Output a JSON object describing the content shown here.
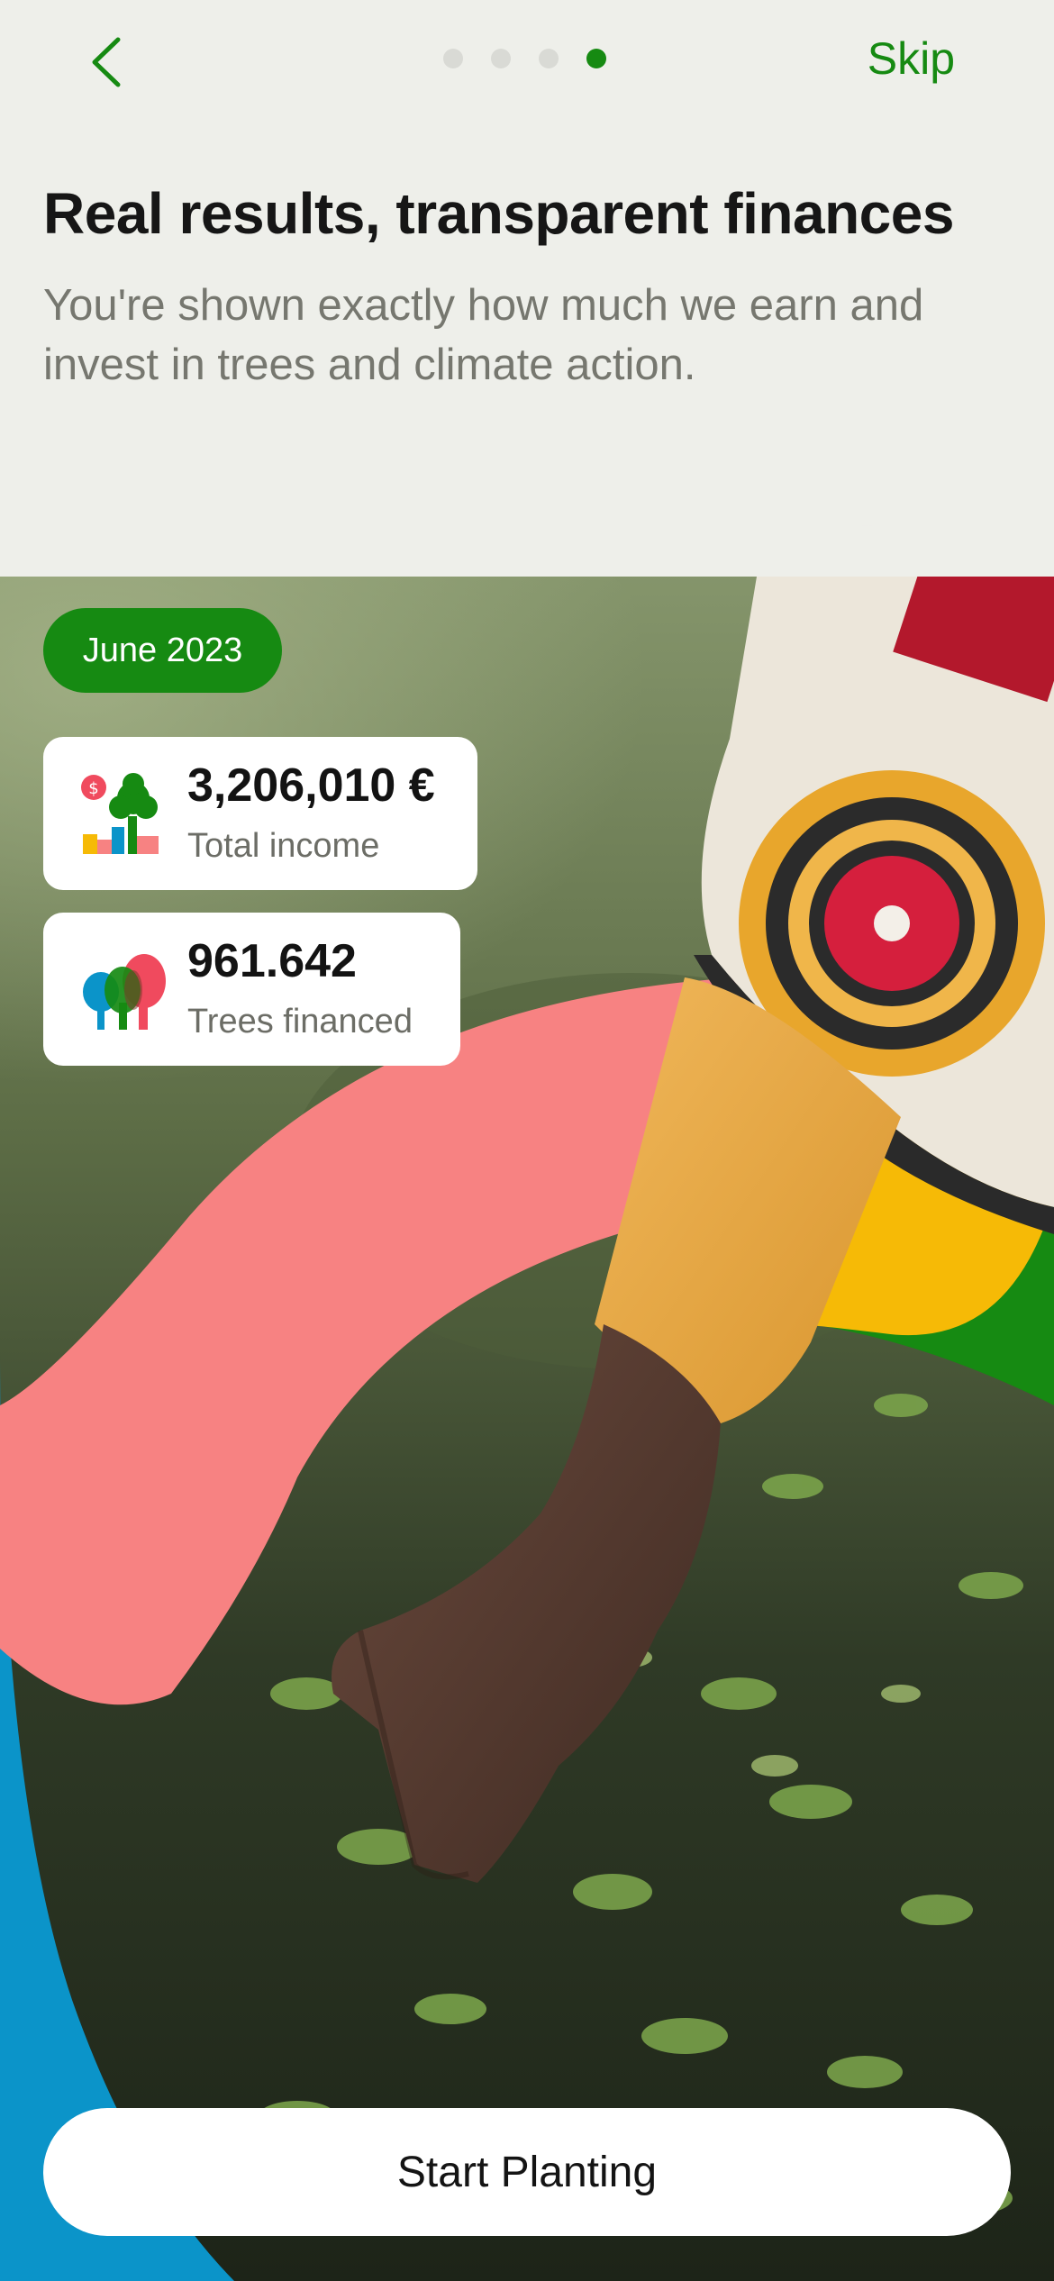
{
  "nav": {
    "back_icon": "chevron-left-icon",
    "skip_label": "Skip",
    "pager_total": 4,
    "pager_active": 4
  },
  "intro": {
    "title": "Real results, transparent finances",
    "subtitle": "You're shown exactly how much we earn and invest in trees and climate action."
  },
  "stats": {
    "period": "June 2023",
    "income": {
      "value": "3,206,010 €",
      "label": "Total income",
      "icon": "income-chart-tree-icon"
    },
    "trees": {
      "value": "961.642",
      "label": "Trees financed",
      "icon": "trees-cluster-icon"
    }
  },
  "cta": {
    "label": "Start Planting"
  },
  "colors": {
    "brand_green": "#168a12",
    "background": "#eeefea",
    "coral": "#f78282",
    "blue": "#0b94c9",
    "yellow": "#f6ba06"
  }
}
